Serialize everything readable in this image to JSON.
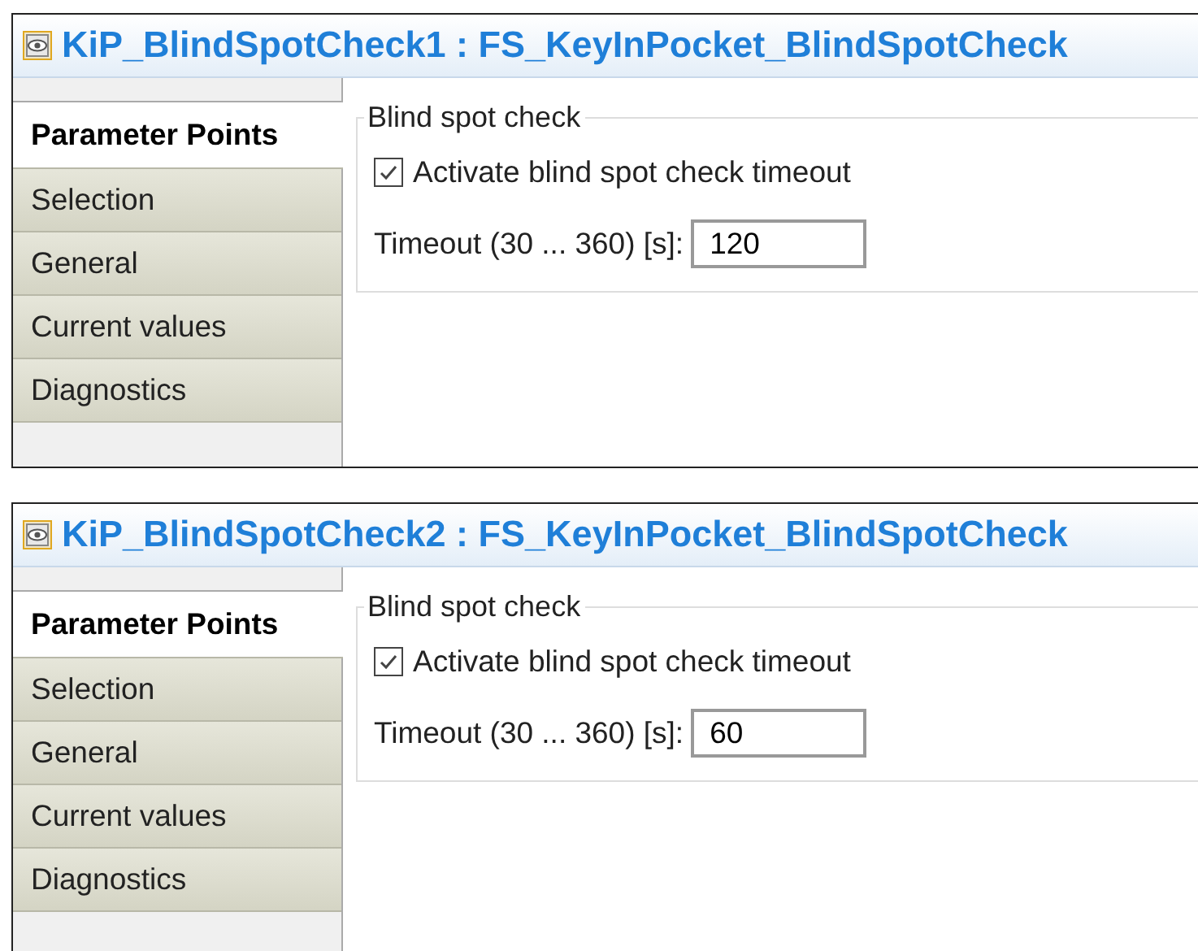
{
  "panels": [
    {
      "title": "KiP_BlindSpotCheck1 : FS_KeyInPocket_BlindSpotCheck",
      "tabs": [
        {
          "label": "Parameter Points",
          "selected": true
        },
        {
          "label": "Selection",
          "selected": false
        },
        {
          "label": "General",
          "selected": false
        },
        {
          "label": "Current values",
          "selected": false
        },
        {
          "label": "Diagnostics",
          "selected": false
        }
      ],
      "group": {
        "title": "Blind spot check",
        "checkbox": {
          "label": "Activate blind spot check timeout",
          "checked": true
        },
        "field": {
          "label": "Timeout (30 ... 360) [s]:",
          "value": "120"
        }
      }
    },
    {
      "title": "KiP_BlindSpotCheck2 : FS_KeyInPocket_BlindSpotCheck",
      "tabs": [
        {
          "label": "Parameter Points",
          "selected": true
        },
        {
          "label": "Selection",
          "selected": false
        },
        {
          "label": "General",
          "selected": false
        },
        {
          "label": "Current values",
          "selected": false
        },
        {
          "label": "Diagnostics",
          "selected": false
        }
      ],
      "group": {
        "title": "Blind spot check",
        "checkbox": {
          "label": "Activate blind spot check timeout",
          "checked": true
        },
        "field": {
          "label": "Timeout (30 ... 360) [s]:",
          "value": "60"
        }
      }
    }
  ]
}
